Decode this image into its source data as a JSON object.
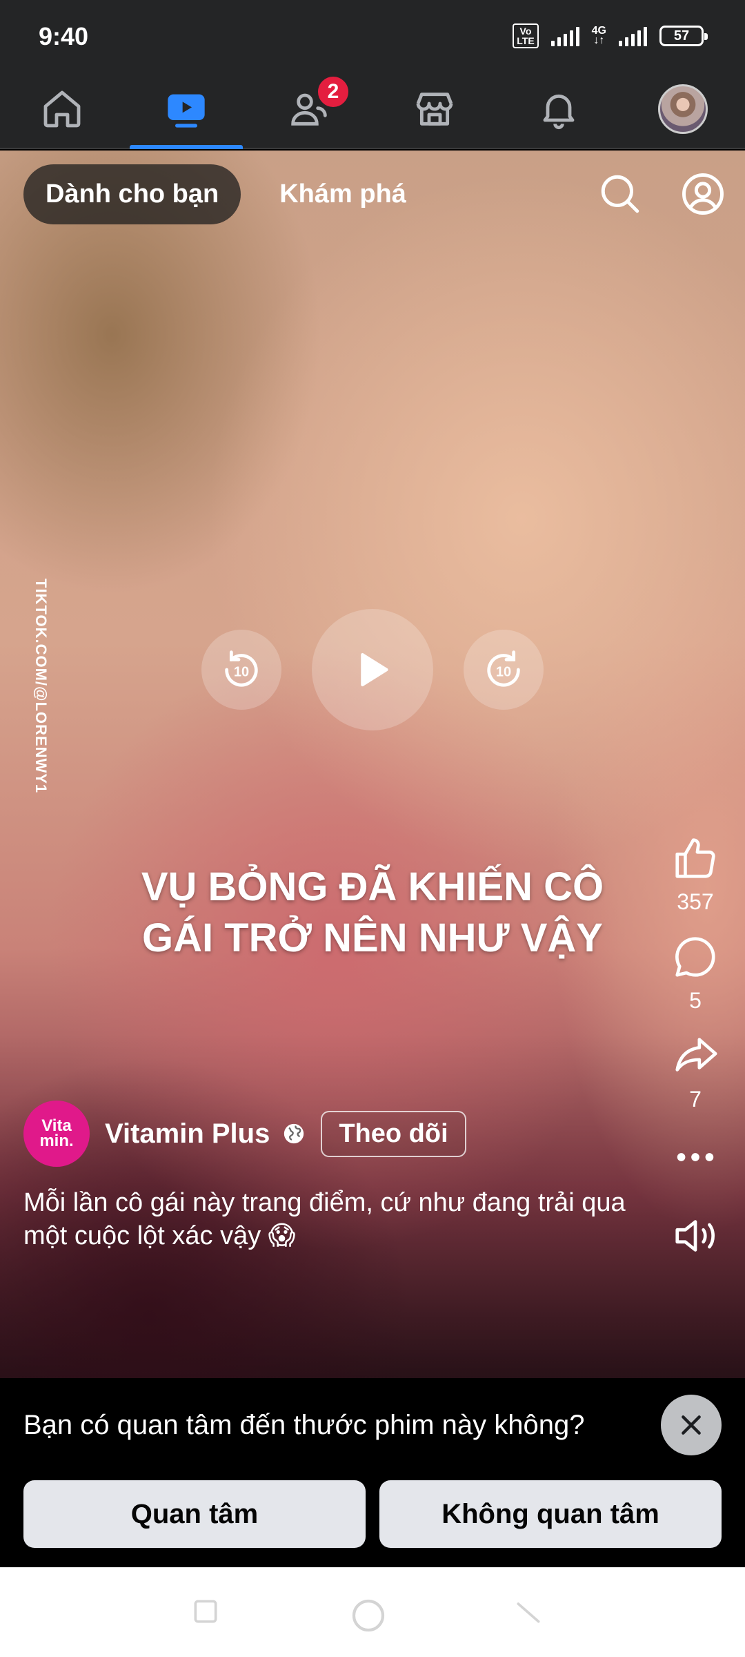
{
  "status_bar": {
    "time": "9:40",
    "volte_label": "Vo LTE",
    "network_label": "4G",
    "battery_level": "57"
  },
  "nav": {
    "tabs": [
      {
        "name": "home",
        "icon": "home-icon",
        "active": false
      },
      {
        "name": "video",
        "icon": "video-icon",
        "active": true
      },
      {
        "name": "friends",
        "icon": "friends-icon",
        "active": false,
        "badge": "2"
      },
      {
        "name": "marketplace",
        "icon": "marketplace-icon",
        "active": false
      },
      {
        "name": "notifications",
        "icon": "bell-icon",
        "active": false
      },
      {
        "name": "profile",
        "icon": "avatar",
        "active": false
      }
    ],
    "friends_badge": "2",
    "accent_color": "#2d88ff"
  },
  "feed": {
    "tab_for_you": "Dành cho bạn",
    "tab_explore": "Khám phá"
  },
  "video": {
    "watermark": "TIKTOK.COM/@LORENWY1",
    "overlay_line1": "VỤ BỎNG ĐÃ KHIẾN CÔ",
    "overlay_line2": "GÁI TRỞ NÊN NHƯ VẬY",
    "rewind_label": "10",
    "forward_label": "10"
  },
  "actions": {
    "likes": "357",
    "comments": "5",
    "shares": "7"
  },
  "author": {
    "avatar_line1": "Vita",
    "avatar_line2": "min.",
    "name": "Vitamin Plus",
    "follow_label": "Theo dõi",
    "brand_color": "#e0198a"
  },
  "caption": "Mỗi lần cô gái này trang điểm, cứ như đang trải qua một cuộc lột xác vậy 😱",
  "prompt": {
    "question": "Bạn có quan tâm đến thước phim này không?",
    "yes_label": "Quan tâm",
    "no_label": "Không quan tâm"
  }
}
